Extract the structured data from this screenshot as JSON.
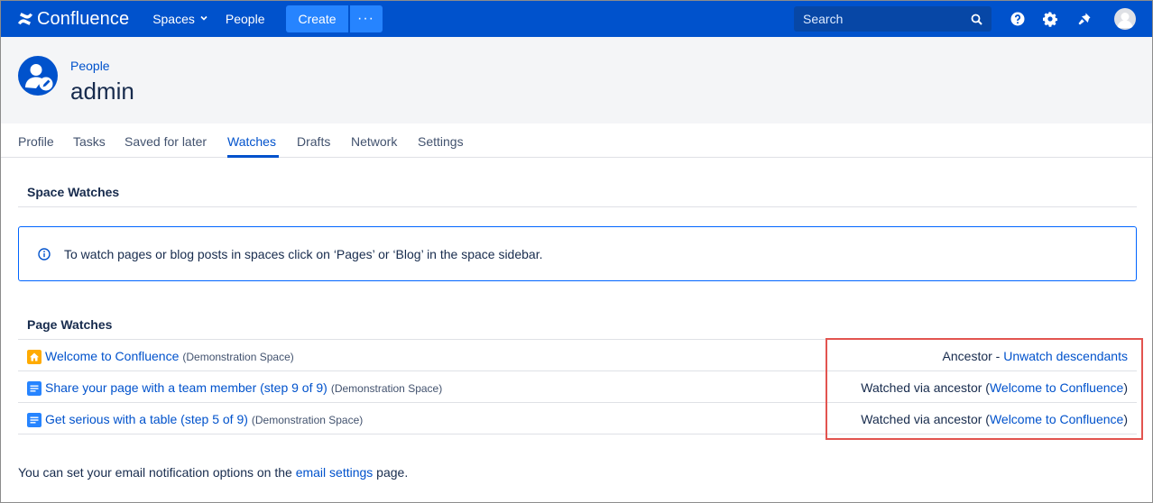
{
  "topnav": {
    "logo_text": "Confluence",
    "spaces_label": "Spaces",
    "people_label": "People",
    "create_label": "Create",
    "more_label": "···",
    "search_placeholder": "Search",
    "icons": [
      "help-icon",
      "gear-icon",
      "notifications-icon",
      "avatar"
    ]
  },
  "profile": {
    "breadcrumb": "People",
    "name": "admin"
  },
  "tabs": [
    {
      "label": "Profile"
    },
    {
      "label": "Tasks"
    },
    {
      "label": "Saved for later"
    },
    {
      "label": "Watches"
    },
    {
      "label": "Drafts"
    },
    {
      "label": "Network"
    },
    {
      "label": "Settings"
    }
  ],
  "space_watches": {
    "title": "Space Watches",
    "info": "To watch pages or blog posts in spaces click on ‘Pages’ or ‘Blog’ in the space sidebar."
  },
  "page_watches": {
    "title": "Page Watches",
    "rows": [
      {
        "title": "Welcome to Confluence",
        "space": "(Demonstration Space)",
        "icon": "home-icon",
        "status": "Ancestor - ",
        "action": "Unwatch descendants"
      },
      {
        "title": "Share your page with a team member (step 9 of 9)",
        "space": "(Demonstration Space)",
        "icon": "page-icon",
        "status": "Watched via ancestor (",
        "ancestor": "Welcome to Confluence",
        "close": ")"
      },
      {
        "title": "Get serious with a table (step 5 of 9)",
        "space": "(Demonstration Space)",
        "icon": "page-icon",
        "status": "Watched via ancestor (",
        "ancestor": "Welcome to Confluence",
        "close": ")"
      }
    ]
  },
  "footer": {
    "before": "You can set your email notification options on the ",
    "link": "email settings",
    "after": " page."
  },
  "colors": {
    "nav_bg": "#0052cc",
    "create_bg": "#2684ff",
    "search_bg": "#0747a6",
    "link": "#0052cc",
    "home_icon": "#ffab00",
    "page_icon": "#2684ff",
    "highlight": "#e2544f"
  }
}
